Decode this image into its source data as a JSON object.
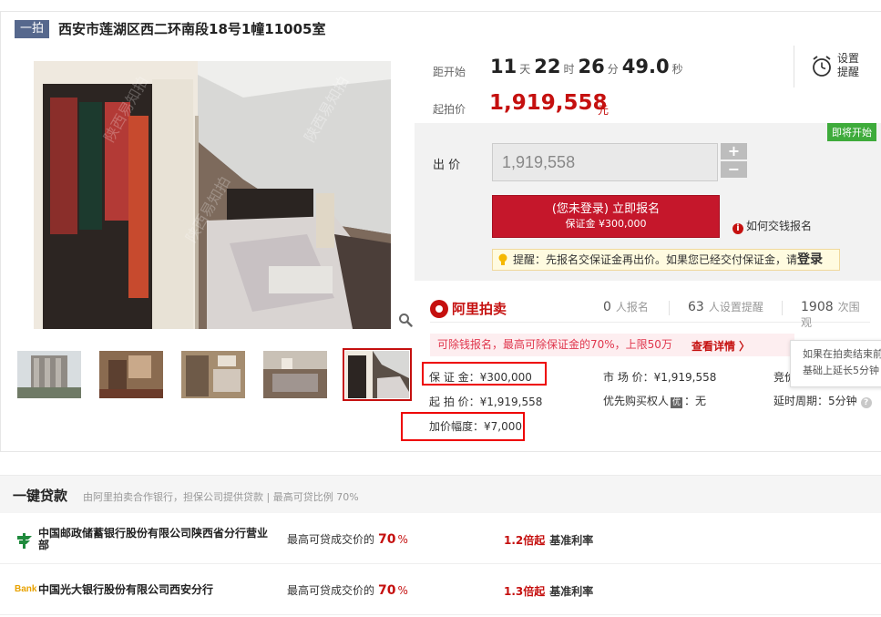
{
  "title": {
    "tag": "一拍",
    "address": "西安市莲湖区西二环南段18号1幢11005室"
  },
  "photo": {
    "watermark": "陕西易知拍"
  },
  "countdown": {
    "label": "距开始",
    "days": "11",
    "days_unit": "天",
    "hours": "22",
    "hours_unit": "时",
    "minutes": "26",
    "minutes_unit": "分",
    "seconds": "49.0",
    "seconds_unit": "秒"
  },
  "reminder": {
    "label": "设置提醒"
  },
  "start_price": {
    "label": "起拍价",
    "value": "1,919,558",
    "unit": "元"
  },
  "bid": {
    "badge": "即将开始",
    "label": "出 价",
    "value": "1,919,558",
    "plus": "+",
    "minus": "−",
    "signup_line1": "(您未登录) 立即报名",
    "signup_line2": "保证金 ¥300,000",
    "how_link": "如何交钱报名",
    "tip_text": "提醒：先报名交保证金再出价。如果您已经交付保证金，请",
    "tip_login": "登录"
  },
  "platform": {
    "name": "阿里拍卖",
    "signups_num": "0",
    "signups_label": "人报名",
    "reminders_num": "63",
    "reminders_label": "人设置提醒",
    "views_num": "1908",
    "views_label": "次围观"
  },
  "promo": {
    "text": "可除钱报名，最高可除保证金的70%，上限50万",
    "link": "查看详情 〉"
  },
  "tooltip": {
    "line1": "如果在拍卖结束前",
    "line2": "基础上延长5分钟"
  },
  "fields": {
    "deposit_label": "保 证 金：",
    "deposit_value": "¥300,000",
    "market_label": "市 场 价：",
    "market_value": "¥1,919,558",
    "bid_partial": "竞价",
    "start_label": "起 拍 价：",
    "start_value": "¥1,919,558",
    "priority_label": "优先购买权人",
    "priority_badge": "优",
    "priority_value": "：无",
    "delay_label": "延时周期：",
    "delay_value": "5分钟",
    "increment_label": "加价幅度：",
    "increment_value": "¥7,000"
  },
  "loan": {
    "title": "一键贷款",
    "subtitle": "由阿里拍卖合作银行，担保公司提供贷款 | 最高可贷比例 70%",
    "banks": [
      {
        "name": "中国邮政储蓄银行股份有限公司陕西省分行营业部",
        "ratio_label": "最高可贷成交价的",
        "ratio": "70",
        "ratio_unit": "%",
        "rate_mult": "1.2倍起",
        "rate_label": "基准利率",
        "logo": "psbc-logo"
      },
      {
        "name": "中国光大银行股份有限公司西安分行",
        "ratio_label": "最高可贷成交价的",
        "ratio": "70",
        "ratio_unit": "%",
        "rate_mult": "1.3倍起",
        "rate_label": "基准利率",
        "logo": "ceb-logo",
        "logo_text": "Bank"
      }
    ]
  },
  "colors": {
    "accent": "#c5100f",
    "tag_bg": "#56688d",
    "badge_green": "#3eab3b"
  }
}
